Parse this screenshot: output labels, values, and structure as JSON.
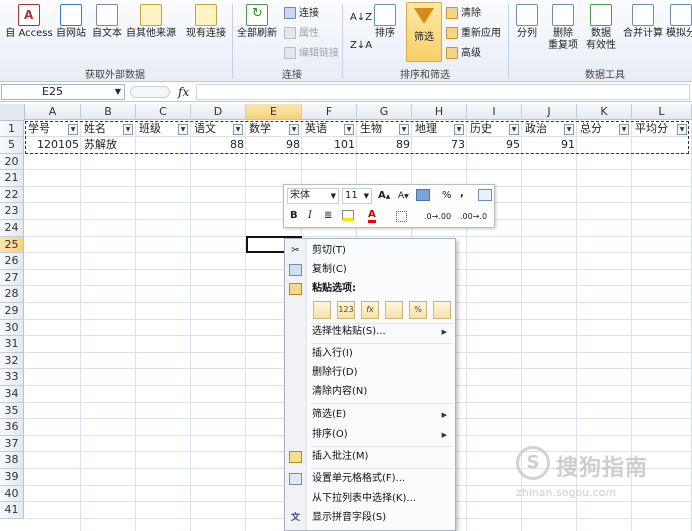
{
  "ribbon": {
    "buttons": {
      "access": "自 Access",
      "web": "自网站",
      "text": "自文本",
      "other": "自其他来源",
      "existing": "现有连接",
      "refresh_all": "全部刷新",
      "sort": "排序",
      "filter": "筛选",
      "split": "分列",
      "remove_dup_1": "删除",
      "remove_dup_2": "重复项",
      "validation_1": "数据",
      "validation_2": "有效性",
      "consolidate": "合并计算",
      "whatif": "模拟分"
    },
    "small": {
      "connections": "连接",
      "properties": "属性",
      "edit_links": "编辑链接",
      "clear": "清除",
      "reapply": "重新应用",
      "advanced": "高级"
    },
    "groups": {
      "external": "获取外部数据",
      "connections": "连接",
      "sort_filter": "排序和筛选",
      "data_tools": "数据工具"
    }
  },
  "formula_bar": {
    "name_box": "E25",
    "fx": "fx",
    "formula": ""
  },
  "columns": [
    "A",
    "B",
    "C",
    "D",
    "E",
    "F",
    "G",
    "H",
    "I",
    "J",
    "K",
    "L"
  ],
  "rows": [
    "1",
    "5",
    "20",
    "21",
    "22",
    "23",
    "24",
    "25",
    "26",
    "27",
    "28",
    "29",
    "30",
    "31",
    "32",
    "33",
    "34",
    "35",
    "36",
    "37",
    "38",
    "39",
    "40",
    "41"
  ],
  "headers": [
    "学号",
    "姓名",
    "班级",
    "语文",
    "数学",
    "英语",
    "生物",
    "地理",
    "历史",
    "政治",
    "总分",
    "平均分"
  ],
  "record": {
    "id": "120105",
    "name": "苏解放",
    "chinese": "88",
    "math": "98",
    "english": "101",
    "biology": "89",
    "geography": "73",
    "history": "95",
    "politics": "91"
  },
  "minibar": {
    "font": "宋体",
    "size": "11",
    "grow": "A",
    "shrink": "A",
    "percent": "%",
    "comma": ",",
    "bold": "B",
    "italic": "I",
    "inc_dec": ".0→.00",
    "dec_dec": ".00→.0"
  },
  "context_menu": {
    "cut": "剪切(T)",
    "copy": "复制(C)",
    "paste_options": "粘贴选项:",
    "paste_special": "选择性粘贴(S)...",
    "insert_row": "插入行(I)",
    "delete_row": "删除行(D)",
    "clear_contents": "清除内容(N)",
    "filter": "筛选(E)",
    "sort": "排序(O)",
    "insert_comment": "插入批注(M)",
    "format_cells": "设置单元格格式(F)...",
    "pick_list": "从下拉列表中选择(K)...",
    "phonetic": "显示拼音字段(S)",
    "paste_icons": [
      "",
      "123",
      "fx",
      "",
      "%",
      ""
    ]
  },
  "watermark": {
    "logo": "S",
    "title": "搜狗指南",
    "url": "zhinan.sogou.com"
  }
}
